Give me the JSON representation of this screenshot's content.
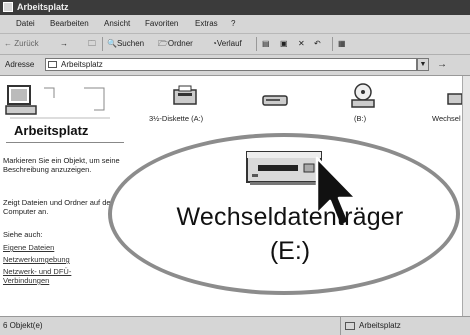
{
  "window": {
    "title": "Arbeitsplatz"
  },
  "menu": [
    "Datei",
    "Bearbeiten",
    "Ansicht",
    "Favoriten",
    "Extras",
    "?"
  ],
  "toolbar": {
    "back": "← Zurück",
    "forward": "→",
    "search": "Suchen",
    "folders": "Ordner",
    "history": "Verlauf",
    "close_glyph": "✕",
    "undo_glyph": "↶",
    "views_glyph": "▦"
  },
  "address": {
    "label": "Adresse",
    "value": "Arbeitsplatz",
    "go": "→"
  },
  "left_panel": {
    "heading": "Arbeitsplatz",
    "description": "Markieren Sie ein Objekt, um seine Beschreibung anzuzeigen.",
    "info": "Zeigt Dateien und Ordner auf dem Computer an.",
    "see_also_label": "Siehe auch:",
    "links": [
      "Eigene Dateien",
      "Netzwerkumgebung",
      "Netzwerk- und DFÜ-Verbindungen"
    ]
  },
  "drives": [
    {
      "label": "3½-Diskette (A:)",
      "icon": "floppy-drive-icon"
    },
    {
      "label": "",
      "icon": "hard-drive-icon"
    },
    {
      "label": "(B:)",
      "icon": "cdrom-drive-icon"
    },
    {
      "label": "Wechsel",
      "icon": "removable-drive-icon"
    }
  ],
  "callout": {
    "title": "Wechseldatenträger",
    "subtitle": "(E:)"
  },
  "status": {
    "left": "6 Objekt(e)",
    "right": "Arbeitsplatz"
  },
  "colors": {
    "titlebar": "#3b3b3b",
    "chrome": "#d6d6d6",
    "callout_border": "#8c8c8c"
  }
}
